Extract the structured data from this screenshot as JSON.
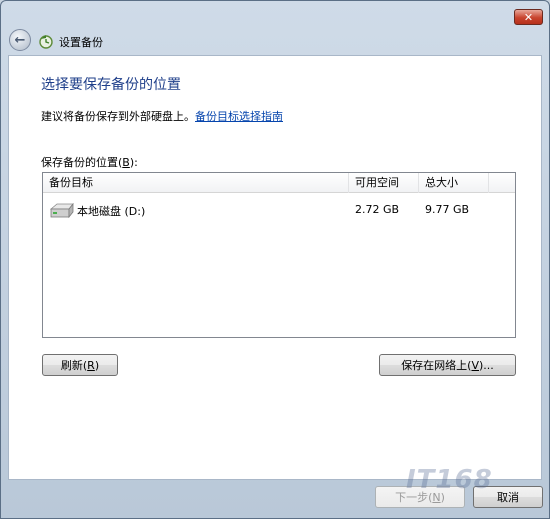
{
  "window": {
    "close_label": "✕",
    "title": "设置备份"
  },
  "main": {
    "heading": "选择要保存备份的位置",
    "advice_prefix": "建议将备份保存到外部硬盘上。",
    "advice_link": "备份目标选择指南",
    "list_label_prefix": "保存备份的位置(",
    "list_label_key": "B",
    "list_label_suffix": "):"
  },
  "table": {
    "columns": [
      "备份目标",
      "可用空间",
      "总大小"
    ],
    "rows": [
      {
        "icon": "hard-drive-icon",
        "target": "本地磁盘 (D:)",
        "free": "2.72 GB",
        "total": "9.77 GB"
      }
    ]
  },
  "buttons": {
    "refresh_prefix": "刷新(",
    "refresh_key": "R",
    "refresh_suffix": ")",
    "network_prefix": "保存在网络上(",
    "network_key": "V",
    "network_suffix": ")...",
    "next_prefix": "下一步(",
    "next_key": "N",
    "next_suffix": ")",
    "cancel": "取消"
  },
  "watermark": "IT168"
}
